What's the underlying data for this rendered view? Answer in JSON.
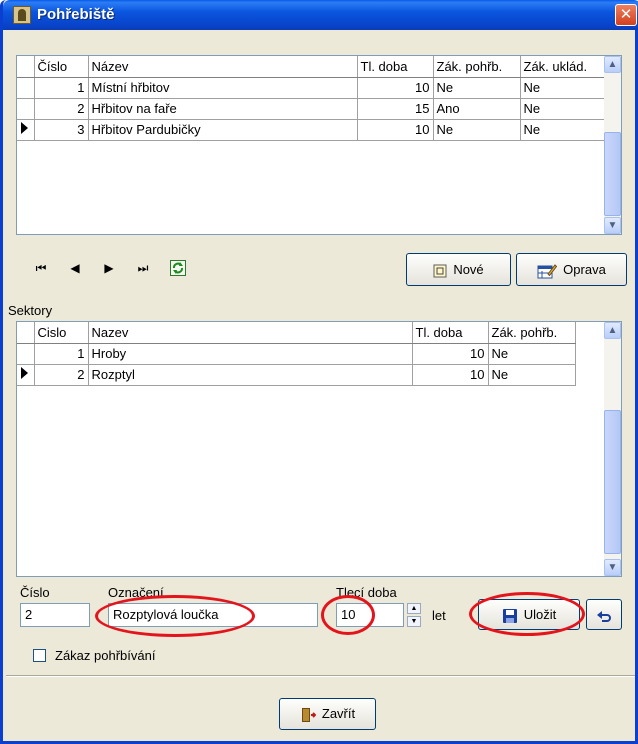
{
  "window": {
    "title": "Pohřebiště",
    "close_glyph": "✕"
  },
  "cemeteries": {
    "columns": [
      "Číslo",
      "Název",
      "Tl. doba",
      "Zák. pohřb.",
      "Zák. uklád."
    ],
    "rows": [
      [
        "1",
        "Místní hřbitov",
        "10",
        "Ne",
        "Ne"
      ],
      [
        "2",
        "Hřbitov na faře",
        "15",
        "Ano",
        "Ne"
      ],
      [
        "3",
        "Hřbitov Pardubičky",
        "10",
        "Ne",
        "Ne"
      ]
    ],
    "selected_row": 2
  },
  "navigator": {
    "first": "⏮",
    "prev": "◀",
    "next": "▶",
    "last": "⏭"
  },
  "buttons": {
    "new_label": "Nové",
    "edit_label": "Oprava",
    "save_label": "Uložit",
    "close_label": "Zavřít"
  },
  "sectors": {
    "title": "Sektory",
    "columns": [
      "Cislo",
      "Nazev",
      "Tl. doba",
      "Zák. pohřb."
    ],
    "rows": [
      [
        "1",
        "Hroby",
        "10",
        "Ne"
      ],
      [
        "2",
        "Rozptyl",
        "10",
        "Ne"
      ]
    ],
    "selected_row": 1
  },
  "form": {
    "number_label": "Číslo",
    "number_value": "2",
    "designation_label": "Označení",
    "designation_value": "Rozptylová loučka",
    "period_label": "Tlecí doba",
    "period_value": "10",
    "period_unit": "let",
    "checkbox_label": "Zákaz pohřbívání",
    "checkbox_checked": false
  },
  "icons": {
    "refresh": "refresh-icon",
    "new": "new-record-icon",
    "edit": "edit-icon",
    "save": "save-disk-icon",
    "undo": "undo-icon",
    "exit": "exit-door-icon"
  },
  "colors": {
    "highlight_oval": "#e3141b",
    "title_bar": "#0a55df"
  }
}
